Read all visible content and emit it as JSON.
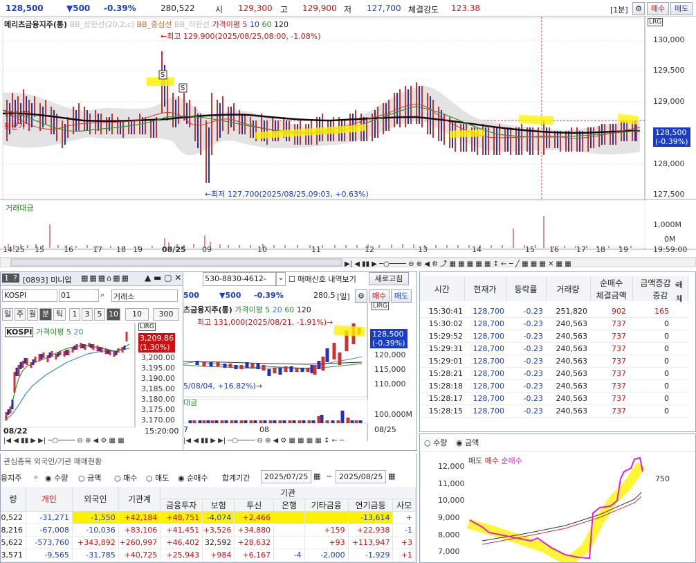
{
  "topbar": {
    "price": "128,500",
    "change": "▼500",
    "change_pct": "-0.39%",
    "volume": "280,522",
    "open_label": "시",
    "open": "129,300",
    "high_label": "고",
    "high": "129,900",
    "low_label": "저",
    "low": "127,700",
    "strength_label": "체결강도",
    "strength": "123.38",
    "interval": "[1분]",
    "buy": "매수",
    "sell": "매도"
  },
  "main_chart": {
    "legend_name": "메리츠금융지주(통)",
    "legend_bb_upper": "BB_상한선(20,2,c)",
    "legend_bb_mid": "BB_중심선",
    "legend_bb_lower": "BB_하한선",
    "legend_ma": "가격이평 5",
    "legend_ma10": "10",
    "legend_ma60": "60",
    "legend_ma120": "120",
    "high_note": "←최고 129,900(2025/08/25,08:00, -1.08%)",
    "low_note": "←최저 127,700(2025/08/25,09:03, +0.63%)",
    "avg_label": "평균가",
    "avg_price": "128,70",
    "y_ticks": [
      "130,000",
      "129,500",
      "129,000",
      "128,500",
      "128,000",
      "127,500"
    ],
    "price_tag": "128,500",
    "price_tag_pct": "(-0.39%)",
    "vol_title": "거래대금",
    "vol_ticks": [
      "1,000M",
      "0M"
    ],
    "x_ticks": [
      "14:25",
      "15",
      "16",
      "17",
      "18",
      "19",
      "08/25",
      "09",
      "10",
      "11",
      "12",
      "13",
      "14",
      "15",
      "16",
      "17",
      "18",
      "19",
      "19:59:00"
    ],
    "sig_s": "S",
    "axis_tag_l": "L",
    "axis_tag_r": "R",
    "axis_tag_g": "G"
  },
  "mini": {
    "title": "[0893] 미니업",
    "code": "KOSPI",
    "num": "01",
    "market": "거래소",
    "periods": [
      "일",
      "주",
      "월",
      "분",
      "틱",
      "1",
      "3",
      "5",
      "10",
      "10",
      "300"
    ],
    "legend": "KOSPI",
    "legend_ma": "가격이평 5",
    "legend_ma20": "20",
    "last": "3,209.86",
    "last_pct": "(1.30%)",
    "y_ticks": [
      "3,200.00",
      "3,195.00",
      "3,190.00",
      "3,185.00",
      "3,180.00",
      "3,175.00",
      "3,170.00"
    ],
    "date_left": "08/22",
    "time_right": "15:20:00"
  },
  "daily": {
    "account": "530-8830-4612-",
    "signal_label": "매매신호 내역보기",
    "refresh": "새로고침",
    "price": "500",
    "change": "▼500",
    "change_pct": "-0.39%",
    "vol": "280,5",
    "period": "[일]",
    "buy": "매수",
    "sell": "매도",
    "legend_name": "츠금융지주(통)",
    "legend_ma": "가격이평 5",
    "legend_20": "20",
    "legend_60": "60",
    "legend_120": "120",
    "high_note": "최고 131,000(2025/08/21, -1.91%)→",
    "low_note": "5/08/04, +16.82%)→",
    "y_ticks": [
      "120,000",
      "115,000",
      "110,000"
    ],
    "price_tag": "128,500",
    "price_tag_pct": "(-0.39%)",
    "vol_title": "대금",
    "vol_tick": "100,000M",
    "x_ticks": [
      "7",
      "08",
      "08/25"
    ]
  },
  "trades": {
    "headers": [
      "시간",
      "현재가",
      "등락률",
      "거래량",
      "순매수",
      "체결금액",
      "증감"
    ],
    "combo": "금액증감",
    "rows": [
      [
        "15:30:41",
        "128,700",
        "-0.23",
        "251,820",
        "902",
        "165"
      ],
      [
        "15:30:02",
        "128,700",
        "-0.23",
        "240,563",
        "737",
        "0"
      ],
      [
        "15:29:52",
        "128,700",
        "-0.23",
        "240,563",
        "737",
        "0"
      ],
      [
        "15:29:31",
        "128,700",
        "-0.23",
        "240,563",
        "737",
        "0"
      ],
      [
        "15:29:01",
        "128,700",
        "-0.23",
        "240,563",
        "737",
        "0"
      ],
      [
        "15:28:21",
        "128,700",
        "-0.23",
        "240,563",
        "737",
        "0"
      ],
      [
        "15:28:18",
        "128,700",
        "-0.23",
        "240,563",
        "737",
        "0"
      ],
      [
        "15:28:17",
        "128,700",
        "-0.23",
        "240,563",
        "737",
        "0"
      ],
      [
        "15:28:15",
        "128,700",
        "-0.23",
        "240,563",
        "737",
        "0"
      ]
    ],
    "extra_col": "매",
    "extra_col2": "체"
  },
  "program": {
    "radio_qty": "수량",
    "radio_amt": "금액",
    "legend_sell": "매도",
    "legend_buy": "매수",
    "legend_net": "순매수",
    "y_ticks": [
      "12,000",
      "11,000",
      "10,000",
      "9,000",
      "8,000",
      "7,000"
    ],
    "right_tick": "750"
  },
  "investors": {
    "tab1": "관심종목 외국인/기관 매매현황",
    "stock": "융지주",
    "radio_qty": "수량",
    "radio_amt": "금액",
    "radio_buy": "매수",
    "radio_sell": "매도",
    "radio_net": "순매수",
    "period_label": "합계기간",
    "from": "2025/07/25",
    "to": "2025/08/25",
    "group_inst": "기관",
    "headers": [
      "량",
      "개인",
      "외국인",
      "기관계",
      "금융투자",
      "보험",
      "투신",
      "은행",
      "기타금융",
      "연기금등",
      "사모"
    ],
    "rows": [
      [
        "0,522",
        "-31,271",
        "-1,550",
        "+42,184",
        "+48,751",
        "-4,074",
        "+2,466",
        "",
        "",
        "-13,614",
        "+"
      ],
      [
        "8,216",
        "-67,008",
        "-10,036",
        "+83,106",
        "+41,451",
        "+3,526",
        "+34,880",
        "",
        "+159",
        "+22,938",
        "-1"
      ],
      [
        "5,622",
        "-573,760",
        "+343,892",
        "+260,997",
        "+46,402",
        "32,592",
        "+28,632",
        "",
        "+93",
        "+113,947",
        "+3"
      ],
      [
        "3,571",
        "-9,565",
        "-31,785",
        "+40,725",
        "+25,943",
        "+984",
        "+6,167",
        "-4",
        "-2,000",
        "-1,929",
        "+1"
      ]
    ]
  }
}
